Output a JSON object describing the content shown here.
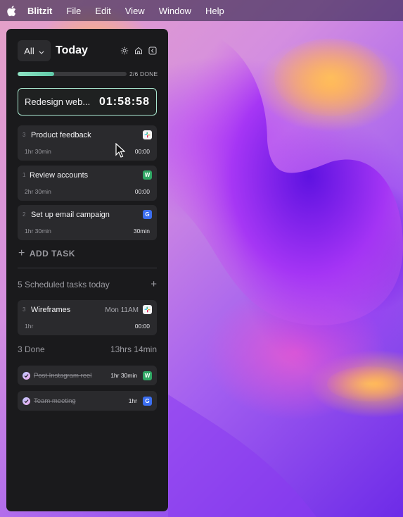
{
  "menubar": {
    "app_name": "Blitzit",
    "items": [
      "File",
      "Edit",
      "View",
      "Window",
      "Help"
    ]
  },
  "header": {
    "filter_value": "All",
    "title": "Today",
    "icons": [
      "gear-icon",
      "home-icon",
      "collapse-icon"
    ]
  },
  "progress": {
    "text": "2/6 DONE",
    "fraction": 0.333
  },
  "active_task": {
    "name": "Redesign web...",
    "timer": "01:58:58"
  },
  "tasks": [
    {
      "num": "3",
      "name": "Product feedback",
      "estimate": "1hr 30min",
      "duration": "00:00",
      "icon": "slack"
    },
    {
      "num": "1",
      "name": "Review accounts",
      "estimate": "2hr 30min",
      "duration": "00:00",
      "icon": "W"
    },
    {
      "num": "2",
      "name": "Set up email campaign",
      "estimate": "1hr 30min",
      "duration": "30min",
      "icon": "G"
    }
  ],
  "add_task_label": "ADD TASK",
  "scheduled": {
    "label": "5 Scheduled tasks today",
    "plus": "+",
    "task": {
      "num": "3",
      "name": "Wireframes",
      "when": "Mon 11AM",
      "estimate": "1hr",
      "duration": "00:00",
      "icon": "slack"
    }
  },
  "done_section": {
    "label": "3 Done",
    "total": "13hrs 14min",
    "items": [
      {
        "name": "Post Instagram reel",
        "duration": "1hr 30min",
        "icon": "W"
      },
      {
        "name": "Team meeting",
        "duration": "1hr",
        "icon": "G"
      }
    ]
  },
  "colors": {
    "accent_green": "#a9e6cf",
    "panel_bg": "#1a1a1c",
    "card_bg": "#2a2a2d",
    "badge_green": "#2fa764",
    "badge_blue": "#3b6ef0"
  }
}
